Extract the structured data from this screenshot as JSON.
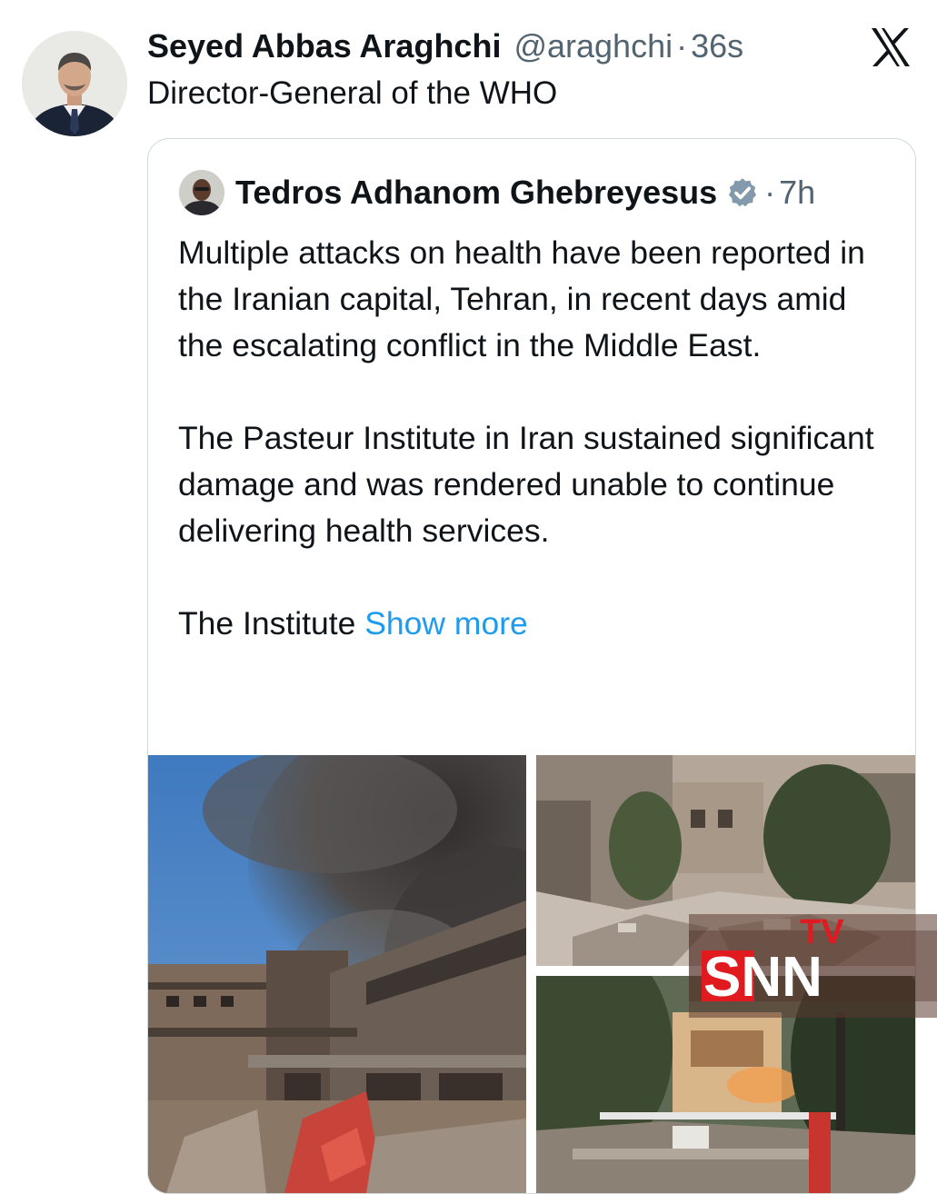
{
  "tweet": {
    "author_name": "Seyed Abbas Araghchi",
    "author_handle": "@araghchi",
    "separator": "·",
    "time": "36s",
    "text": "Director-General of the WHO"
  },
  "quoted_tweet": {
    "author_name": "Tedros Adhanom Ghebreyesus",
    "separator": "·",
    "time": "7h",
    "paragraphs": [
      "Multiple attacks on health have been reported in the Iranian capital, Tehran, in recent days amid the escalating conflict in the Middle East.",
      "The Pasteur Institute in Iran sustained significant damage and was rendered unable to continue delivering health services."
    ],
    "truncated_text": "The Institute",
    "show_more_label": "Show more"
  },
  "watermark": {
    "brand": "SNN",
    "brand_tv": "TV"
  },
  "icons": {
    "platform_logo": "x-logo-icon",
    "verified": "verified-badge-icon"
  },
  "colors": {
    "text_primary": "#0f1419",
    "text_secondary": "#536471",
    "link": "#1d9bf0",
    "border": "#cfd9de",
    "verified_badge": "#829aab",
    "watermark_red": "#e01a1f"
  }
}
